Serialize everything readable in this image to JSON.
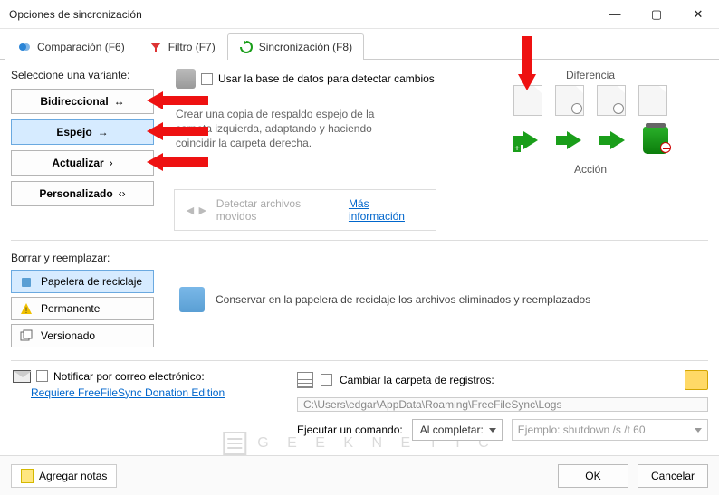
{
  "window": {
    "title": "Opciones de sincronización"
  },
  "tabs": {
    "compare": "Comparación (F6)",
    "filter": "Filtro (F7)",
    "sync": "Sincronización (F8)"
  },
  "variants": {
    "label": "Seleccione una variante:",
    "bidirectional": "Bidireccional",
    "mirror": "Espejo",
    "update": "Actualizar",
    "custom": "Personalizado"
  },
  "db_checkbox": "Usar la base de datos para detectar cambios",
  "description": "Crear una copia de respaldo espejo de la carpeta izquierda, adaptando y haciendo coincidir la carpeta derecha.",
  "detect": {
    "text": "Detectar archivos movidos",
    "link": "Más información"
  },
  "right": {
    "difference": "Diferencia",
    "action": "Acción"
  },
  "delete": {
    "label": "Borrar y reemplazar:",
    "recycle": "Papelera de reciclaje",
    "permanent": "Permanente",
    "versioning": "Versionado",
    "desc": "Conservar en la papelera de reciclaje los archivos eliminados y reemplazados"
  },
  "email": {
    "notify": "Notificar por correo electrónico:",
    "donation": "Requiere FreeFileSync Donation Edition"
  },
  "logs": {
    "change": "Cambiar la carpeta de registros:",
    "path": "C:\\Users\\edgar\\AppData\\Roaming\\FreeFileSync\\Logs",
    "execute": "Ejecutar un comando:",
    "when": "Al completar:",
    "example": "Ejemplo: shutdown /s /t 60"
  },
  "footer": {
    "notes": "Agregar notas",
    "ok": "OK",
    "cancel": "Cancelar"
  },
  "watermark": "G E E K N E T I C"
}
